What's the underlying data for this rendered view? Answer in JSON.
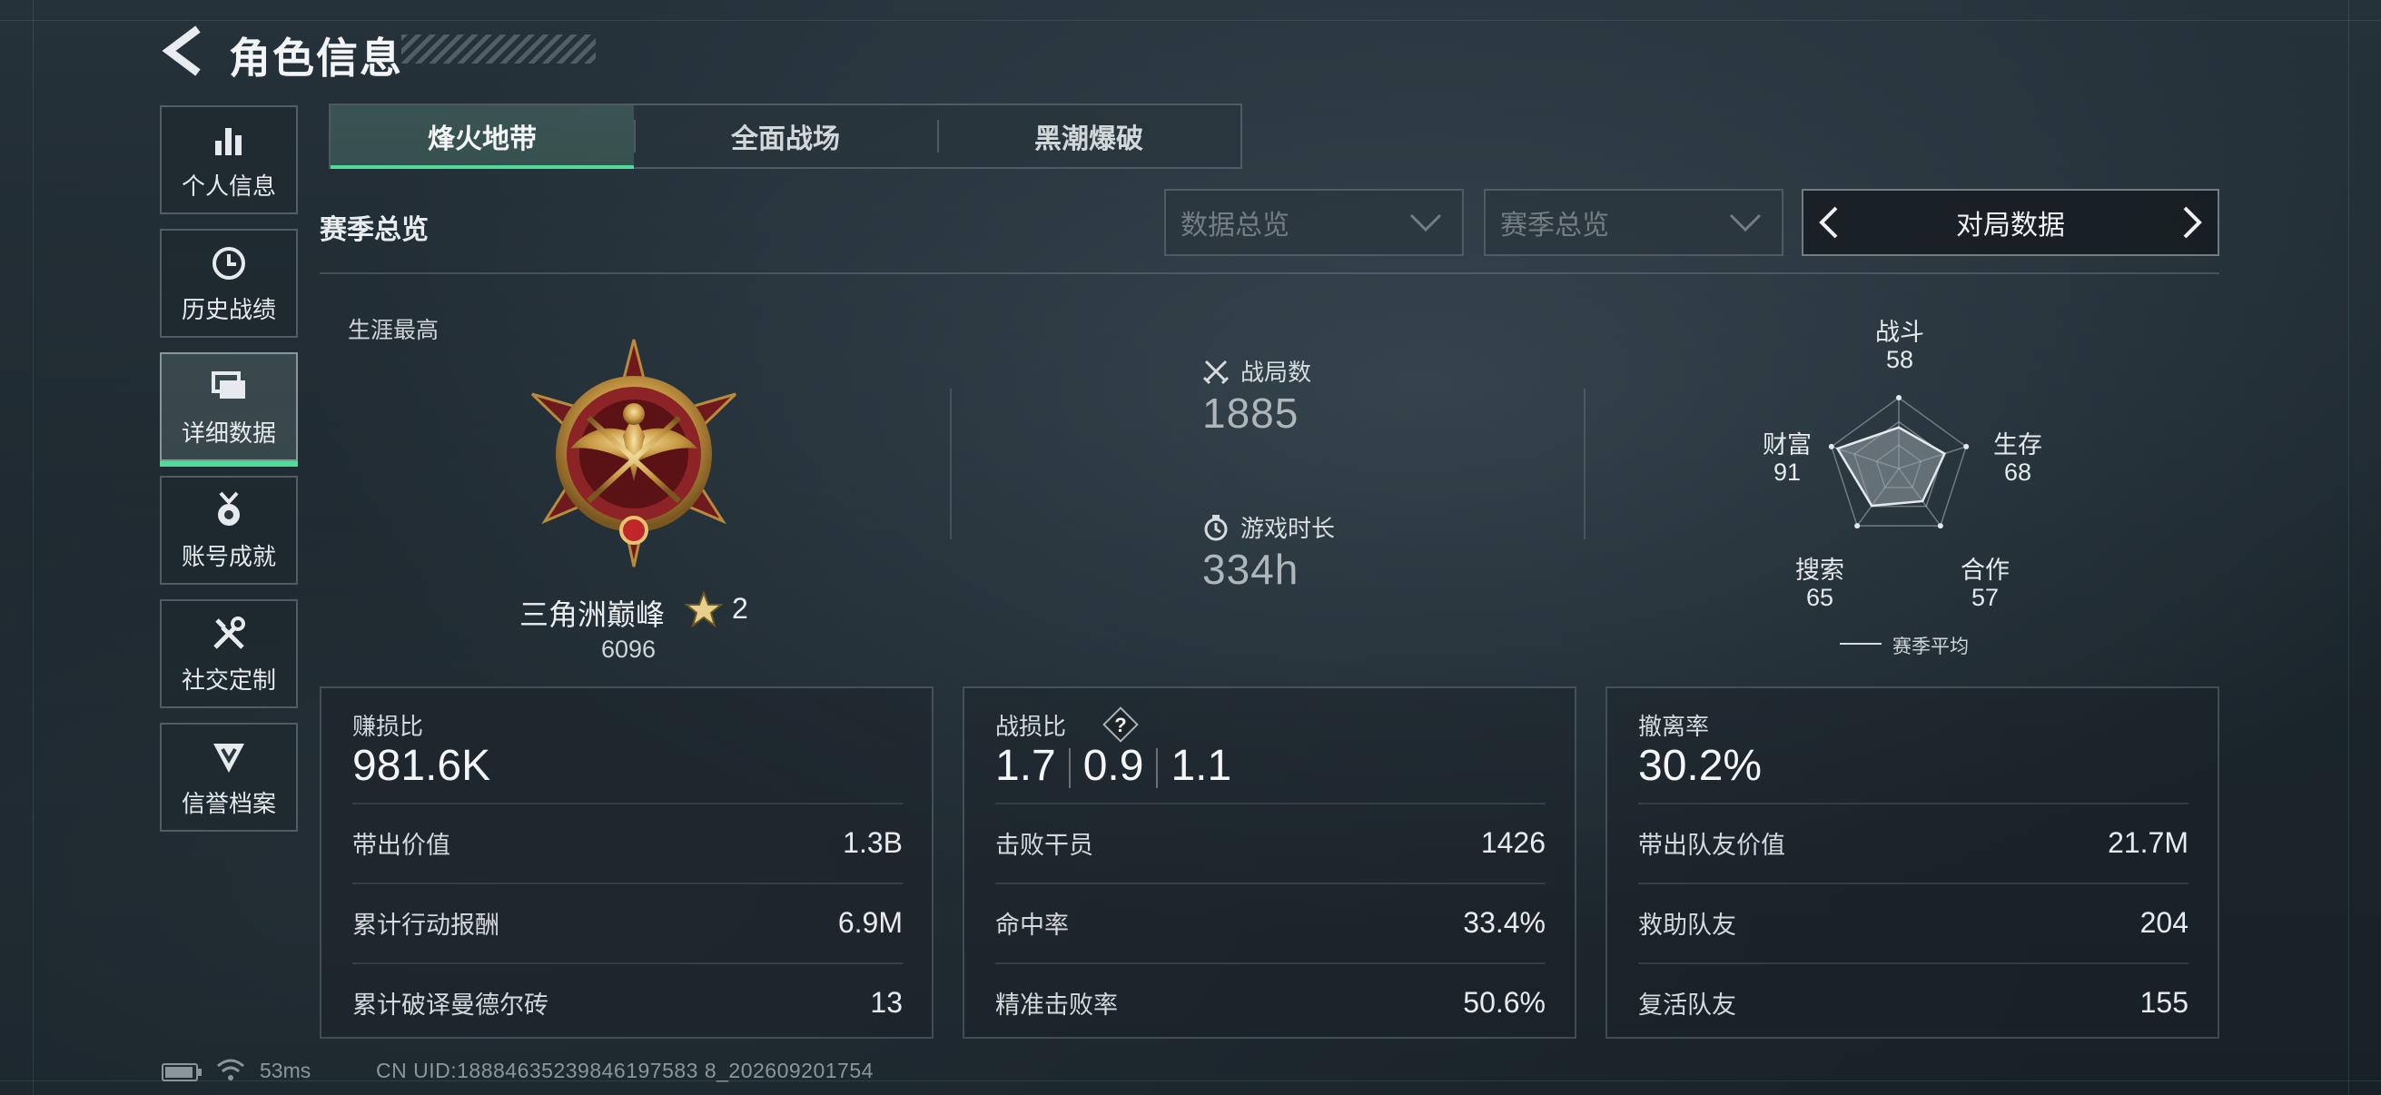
{
  "header": {
    "title": "角色信息"
  },
  "sidebar": {
    "items": [
      {
        "label": "个人信息",
        "icon": "bar-chart-icon",
        "active": false
      },
      {
        "label": "历史战绩",
        "icon": "clock-icon",
        "active": false
      },
      {
        "label": "详细数据",
        "icon": "cards-icon",
        "active": true
      },
      {
        "label": "账号成就",
        "icon": "medal-icon",
        "active": false
      },
      {
        "label": "社交定制",
        "icon": "tools-icon",
        "active": false
      },
      {
        "label": "信誉档案",
        "icon": "shield-icon",
        "active": false
      }
    ]
  },
  "tabs": [
    {
      "label": "烽火地带",
      "active": true
    },
    {
      "label": "全面战场",
      "active": false
    },
    {
      "label": "黑潮爆破",
      "active": false
    }
  ],
  "section": {
    "title": "赛季总览",
    "dropdown_data": "数据总览",
    "dropdown_season": "赛季总览",
    "pager_label": "对局数据"
  },
  "career": {
    "label": "生涯最高",
    "rank_name": "三角洲巅峰",
    "rank_level": "2",
    "rank_score": "6096"
  },
  "stats": {
    "matches_label": "战局数",
    "matches_value": "1885",
    "playtime_label": "游戏时长",
    "playtime_value": "334h"
  },
  "radar": {
    "axes": [
      {
        "name": "战斗",
        "value": "58"
      },
      {
        "name": "生存",
        "value": "68"
      },
      {
        "name": "合作",
        "value": "57"
      },
      {
        "name": "搜索",
        "value": "65"
      },
      {
        "name": "财富",
        "value": "91"
      }
    ],
    "legend": "赛季平均"
  },
  "cards": [
    {
      "title": "赚损比",
      "big": "981.6K",
      "rows": [
        {
          "label": "带出价值",
          "value": "1.3B"
        },
        {
          "label": "累计行动报酬",
          "value": "6.9M"
        },
        {
          "label": "累计破译曼德尔砖",
          "value": "13"
        }
      ]
    },
    {
      "title": "战损比",
      "big_parts": [
        "1.7",
        "0.9",
        "1.1"
      ],
      "help": "?",
      "rows": [
        {
          "label": "击败干员",
          "value": "1426"
        },
        {
          "label": "命中率",
          "value": "33.4%"
        },
        {
          "label": "精准击败率",
          "value": "50.6%"
        }
      ]
    },
    {
      "title": "撤离率",
      "big": "30.2%",
      "rows": [
        {
          "label": "带出队友价值",
          "value": "21.7M"
        },
        {
          "label": "救助队友",
          "value": "204"
        },
        {
          "label": "复活队友",
          "value": "155"
        }
      ]
    }
  ],
  "status": {
    "ping": "53ms",
    "uid": "CN UID:18884635239846197583 8_202609201754"
  },
  "colors": {
    "accent": "#4fdc9a",
    "background": "#1f2a31"
  }
}
